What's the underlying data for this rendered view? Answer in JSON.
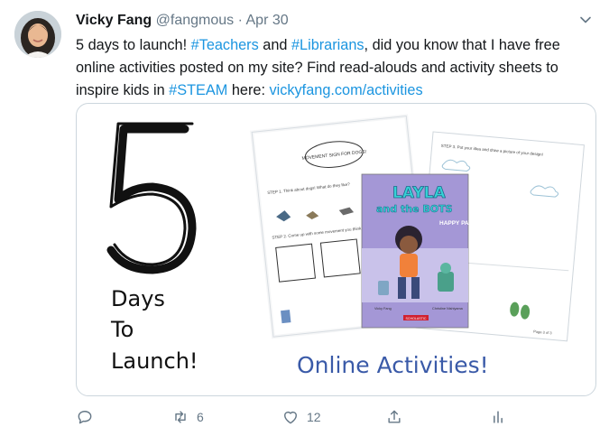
{
  "tweet": {
    "author_name": "Vicky Fang",
    "author_handle": "@fangmous",
    "separator": "·",
    "date": "Apr 30",
    "text_segments": [
      {
        "text": "5 days to launch! ",
        "link": false
      },
      {
        "text": "#Teachers",
        "link": true
      },
      {
        "text": " and ",
        "link": false
      },
      {
        "text": "#Librarians",
        "link": true
      },
      {
        "text": ", did you know that I have free online activities posted on my site? Find read-alouds and activity sheets to inspire kids in ",
        "link": false
      },
      {
        "text": "#STEAM",
        "link": true
      },
      {
        "text": " here: ",
        "link": false
      },
      {
        "text": "vickyfang.com/activities",
        "link": true
      }
    ]
  },
  "media": {
    "big_number": "5",
    "days_lines": [
      "Days",
      "To",
      "Launch!"
    ],
    "caption": "Online Activities!",
    "sheet_left": {
      "cloud_label": "MOVEMENT SIGN FOR DOGS!",
      "step1": "STEP 1. Think about dogs! What do they like?",
      "step2": "STEP 2. Come up with some movement you think they..."
    },
    "sheet_right": {
      "step3": "STEP 3. Put your idea and draw a picture of your design!",
      "page": "Page 3 of 3"
    },
    "book": {
      "title_line1": "LAYLA",
      "title_line2": "and the BOTS",
      "subtitle": "HAPPY PAWS",
      "author": "Vicky Fang",
      "illustrator": "Christine Nishiyama",
      "publisher": "SCHOLASTIC"
    }
  },
  "actions": {
    "reply_count": "",
    "retweet_count": "6",
    "like_count": "12",
    "share_count": "",
    "analytics_count": ""
  },
  "colors": {
    "link": "#1b95e0",
    "secondary": "#657786",
    "caption_blue": "#3a5aa8",
    "book_purple": "#9a8ed0",
    "book_teal": "#2fc4c9"
  }
}
